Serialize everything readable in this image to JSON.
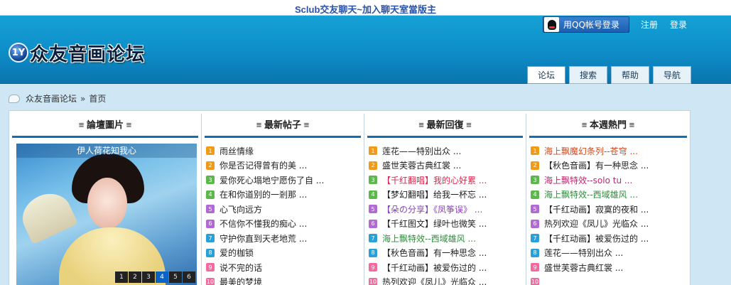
{
  "topbar": {
    "link": "Sclub交友聊天~加入聊天室當版主"
  },
  "header": {
    "logo_badge": "1Y",
    "logo_text": "众友音画论坛",
    "qq_login": "用QQ帐号登录",
    "register": "注册",
    "login": "登录",
    "tabs": [
      "论坛",
      "搜索",
      "帮助",
      "导航"
    ]
  },
  "breadcrumb": {
    "forum": "众友音画论坛",
    "sep": "»",
    "current": "首页"
  },
  "columns": {
    "pictures": {
      "title": "≡ 論壇圖片 ≡",
      "caption": "伊人荷花知我心",
      "pages": [
        "1",
        "2",
        "3",
        "4",
        "5",
        "6"
      ]
    },
    "new_posts": {
      "title": "≡ 最新帖子 ≡",
      "items": [
        "雨丝情缘",
        "你是否记得曾有的美 ...",
        "爱你死心塌地宁愿伤了自 ...",
        "在和你道别的一剎那 ...",
        "心飞向远方",
        "不信你不懂我的痴心 ...",
        "守护你直到天老地荒 ...",
        "爱的枷锁",
        "说不完的话",
        "最美的梦境"
      ]
    },
    "new_replies": {
      "title": "≡ 最新回復 ≡",
      "items": [
        "莲花——特别出众 ...",
        "盛世芙蓉古典红裳 ...",
        "【千红翻唱】我的心好累 ...",
        "【梦幻翻唱】给我一杯忘 ...",
        "【朵の分享】《凤筝误》 ...",
        "【千红图文】绿叶也微笑 ...",
        "海上飘特效--西域雄风 ...",
        "【秋色音画】有一种思念 ...",
        "【千红动画】被爱伤过的 ...",
        "热列欢迎《凤儿》光临众 ..."
      ]
    },
    "hot_week": {
      "title": "≡ 本週熱門 ≡",
      "items": [
        "海上飘魔幻条列--苍穹 ...",
        "【秋色音画】有一种思念 ...",
        "海上飘特效--solo tu ...",
        "海上飘特效--西域雄风 ...",
        "【千红动画】寂寞的夜和 ...",
        "热列欢迎《凤儿》光临众 ...",
        "【千红动画】被爱伤过的 ...",
        "莲花——特别出众 ...",
        "盛世芙蓉古典红裳 ...",
        ""
      ]
    }
  },
  "colors": {
    "rank": [
      "#f09a1a",
      "#f09a1a",
      "#5cb84a",
      "#5cb84a",
      "#b06ad4",
      "#b06ad4",
      "#2aa0d8",
      "#2aa0d8",
      "#f06ca0",
      "#f06ca0"
    ],
    "header_blue": "#0e8dc8",
    "head_line": "#0f6fb5"
  }
}
